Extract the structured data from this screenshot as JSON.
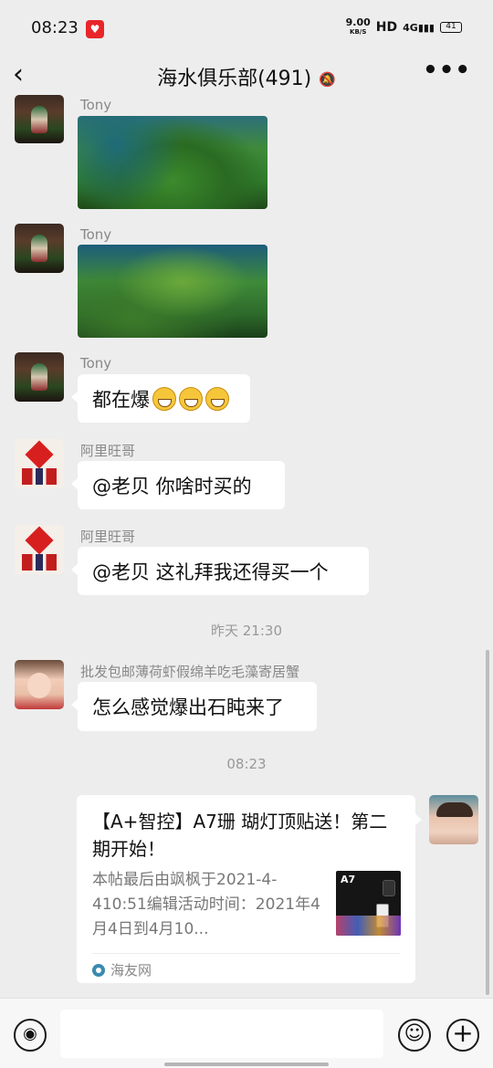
{
  "status_bar": {
    "time": "08:23",
    "net_speed": "9.00",
    "net_unit": "KB/S",
    "hd": "HD",
    "signal": "4G",
    "battery": "41"
  },
  "header": {
    "back_icon": "chevron-left-icon",
    "title": "海水俱乐部(491)",
    "mute_icon": "bell-muted-icon",
    "more_label": "•••"
  },
  "messages": [
    {
      "sender": "Tony",
      "type": "image",
      "avatar": "tony"
    },
    {
      "sender": "Tony",
      "type": "image",
      "avatar": "tony"
    },
    {
      "sender": "Tony",
      "type": "text",
      "text": "都在爆",
      "emoji_count": 3
    },
    {
      "sender": "阿里旺哥",
      "type": "text",
      "text": "@老贝  你啥时买的"
    },
    {
      "sender": "阿里旺哥",
      "type": "text",
      "text": "@老贝  这礼拜我还得买一个"
    },
    {
      "sender": "批发包邮薄荷虾假绵羊吃毛藻寄居蟹",
      "type": "text",
      "text": "怎么感觉爆出石盹来了"
    }
  ],
  "timestamps": [
    "昨天 21:30",
    "08:23"
  ],
  "link_card": {
    "title": "【A+智控】A7珊 瑚灯顶贴送！第二期开始！",
    "description": "本帖最后由飒枫于2021-4-410:51编辑活动时间：2021年4月4日到4月10...",
    "thumb_label": "A7",
    "source": "海友网"
  },
  "input_bar": {
    "voice_icon": "voice-icon",
    "placeholder": "",
    "emoji_icon": "emoji-icon",
    "plus_icon": "plus-icon"
  },
  "colors": {
    "background": "#ededed",
    "bubble": "#ffffff",
    "meta_text": "#888888"
  }
}
